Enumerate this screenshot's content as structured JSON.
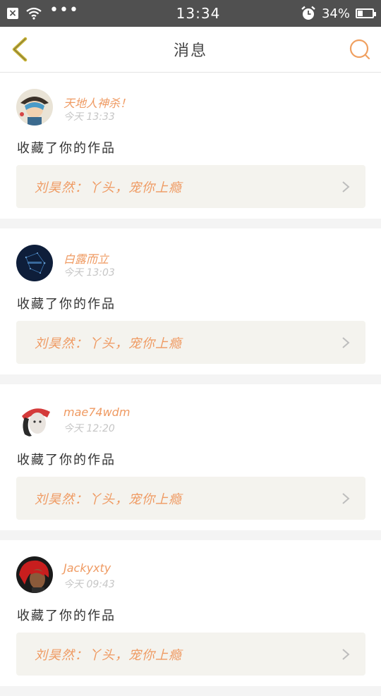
{
  "status_bar": {
    "time": "13:34",
    "battery_percent": "34%",
    "battery_level": 0.34,
    "icons": [
      "close-notification-icon",
      "wifi-icon",
      "more-dots-icon",
      "alarm-icon",
      "battery-icon"
    ]
  },
  "nav": {
    "title": "消息",
    "back_icon": "back-chevron-icon",
    "search_icon": "search-icon",
    "accent_color": "#f0a060"
  },
  "messages": [
    {
      "username": "天地人神杀！",
      "time": "今天 13:33",
      "action": "收藏了你的作品",
      "quote": "刘昊然：丫头，宠你上瘾"
    },
    {
      "username": "白露而立",
      "time": "今天 13:03",
      "action": "收藏了你的作品",
      "quote": "刘昊然：丫头，宠你上瘾"
    },
    {
      "username": "mae74wdm",
      "time": "今天 12:20",
      "action": "收藏了你的作品",
      "quote": "刘昊然：丫头，宠你上瘾"
    },
    {
      "username": "Jackyxty",
      "time": "今天 09:43",
      "action": "收藏了你的作品",
      "quote": "刘昊然：丫头，宠你上瘾"
    }
  ],
  "colors": {
    "username": "#ef9a62",
    "quote_text": "#ef9a62",
    "quote_bg": "#f4f3ee",
    "status_bar_bg": "#505050"
  }
}
